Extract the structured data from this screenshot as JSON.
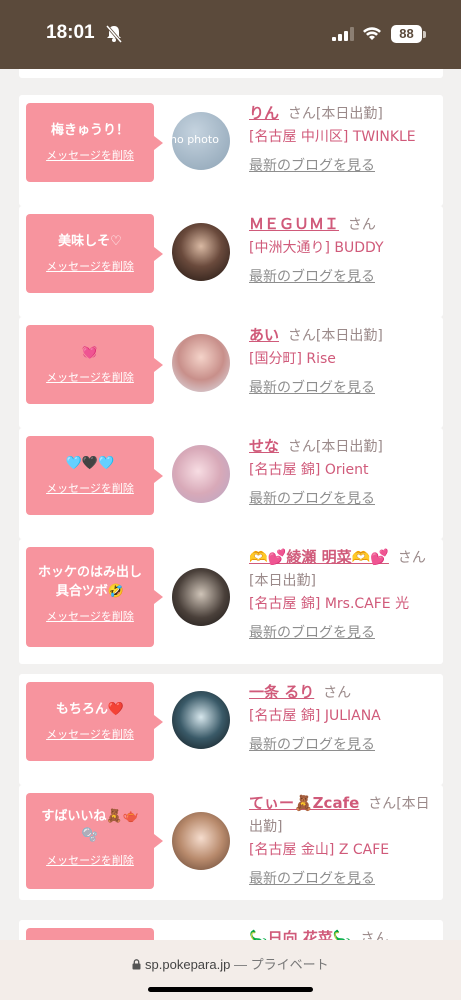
{
  "status": {
    "time": "18:01",
    "battery": "88"
  },
  "cards": [
    {
      "message": "梅きゅうり！",
      "delete_label": "メッセージを削除",
      "name": "りん",
      "san": "さん",
      "tag": "[本日出勤]",
      "shop": "[名古屋 中川区] TWINKLE",
      "blog": "最新のブログを見る",
      "avatar_label": "no photo"
    },
    {
      "message": "美味しそ♡",
      "delete_label": "メッセージを削除",
      "name": "ＭＥＧＵＭＩ",
      "san": "さん",
      "tag": "",
      "shop": "[中洲大通り] BUDDY",
      "blog": "最新のブログを見る"
    },
    {
      "message": "💓",
      "delete_label": "メッセージを削除",
      "name": "あい",
      "san": "さん",
      "tag": "[本日出勤]",
      "shop": "[国分町] Rise",
      "blog": "最新のブログを見る"
    },
    {
      "message": "🩵🖤🩵",
      "delete_label": "メッセージを削除",
      "name": "せな",
      "san": "さん",
      "tag": "[本日出勤]",
      "shop": "[名古屋 錦] Orient",
      "blog": "最新のブログを見る"
    },
    {
      "message": "ホッケのはみ出し具合ツボ🤣",
      "delete_label": "メッセージを削除",
      "name": "🫶💕綾瀬 明菜🫶💕",
      "san": "さん",
      "tag": "[本日出勤]",
      "shop": "[名古屋 錦] Mrs.CAFE 光",
      "blog": "最新のブログを見る"
    },
    {
      "message": "もちろん❤️",
      "delete_label": "メッセージを削除",
      "name": "一条 るり",
      "san": "さん",
      "tag": "",
      "shop": "[名古屋 錦] JULIANA",
      "blog": "最新のブログを見る"
    },
    {
      "message": "すばいいね🧸🫖🫧",
      "delete_label": "メッセージを削除",
      "name": "てぃー🧸Zcafe",
      "san": "さん",
      "tag": "[本日出勤]",
      "shop": "[名古屋 金山] Z CAFE",
      "blog": "最新のブログを見る"
    },
    {
      "message": "",
      "delete_label": "",
      "name": "🦕日向 花菜🦕",
      "san": "さん",
      "tag": "",
      "shop": "",
      "blog": ""
    }
  ],
  "browser": {
    "url": "sp.pokepara.jp",
    "mode": "— プライベート"
  }
}
